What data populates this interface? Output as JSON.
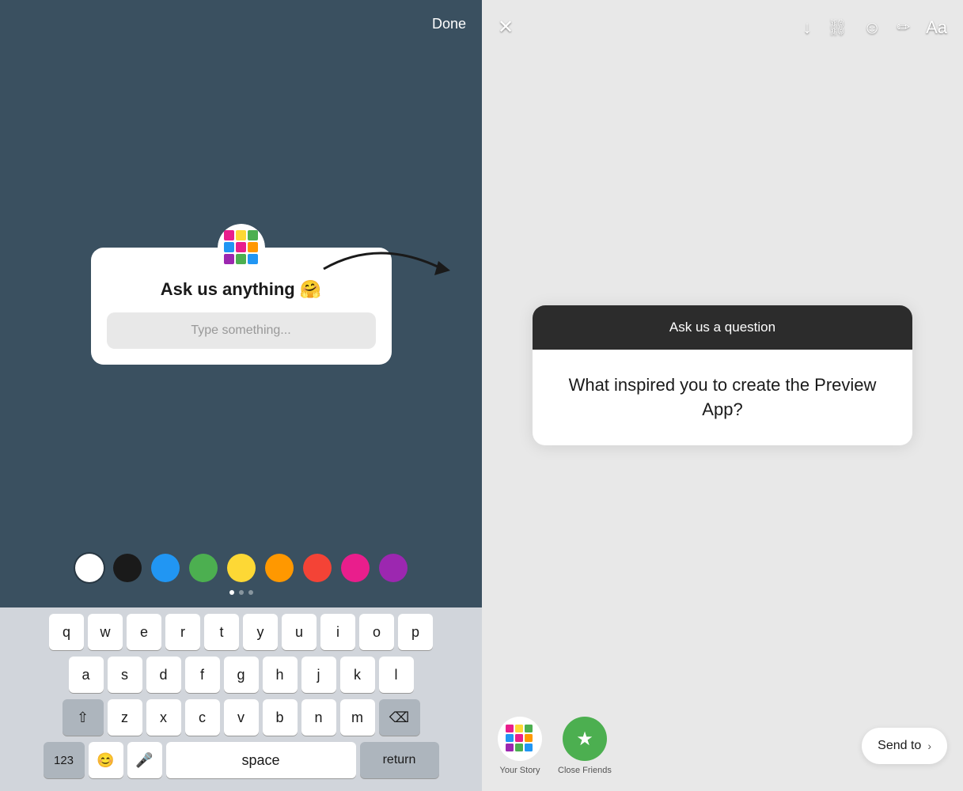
{
  "left": {
    "done_label": "Done",
    "card": {
      "title": "Ask us anything 🤗",
      "placeholder": "Type something..."
    },
    "colors": [
      {
        "name": "white",
        "hex": "#ffffff",
        "selected": true
      },
      {
        "name": "black",
        "hex": "#1a1a1a"
      },
      {
        "name": "blue",
        "hex": "#2196f3"
      },
      {
        "name": "green",
        "hex": "#4caf50"
      },
      {
        "name": "yellow",
        "hex": "#fdd835"
      },
      {
        "name": "orange",
        "hex": "#ff9800"
      },
      {
        "name": "red",
        "hex": "#f44336"
      },
      {
        "name": "pink",
        "hex": "#e91e8c"
      },
      {
        "name": "purple",
        "hex": "#9c27b0"
      }
    ],
    "keyboard": {
      "rows": [
        [
          "q",
          "w",
          "e",
          "r",
          "t",
          "y",
          "u",
          "i",
          "o",
          "p"
        ],
        [
          "a",
          "s",
          "d",
          "f",
          "g",
          "h",
          "j",
          "k",
          "l"
        ],
        [
          "⇧",
          "z",
          "x",
          "c",
          "v",
          "b",
          "n",
          "m",
          "⌫"
        ],
        [
          "123",
          "😊",
          "🎤",
          "space",
          "return"
        ]
      ]
    }
  },
  "right": {
    "toolbar": {
      "close_icon": "✕",
      "download_icon": "↓",
      "link_icon": "🔗",
      "sticker_icon": "☺",
      "draw_icon": "✏",
      "text_icon": "Aa"
    },
    "question_card": {
      "header": "Ask us a question",
      "body": "What inspired you to create the Preview App?"
    },
    "bottom": {
      "your_story_label": "Your Story",
      "close_friends_label": "Close Friends",
      "send_to_label": "Send to",
      "chevron": "›"
    }
  }
}
